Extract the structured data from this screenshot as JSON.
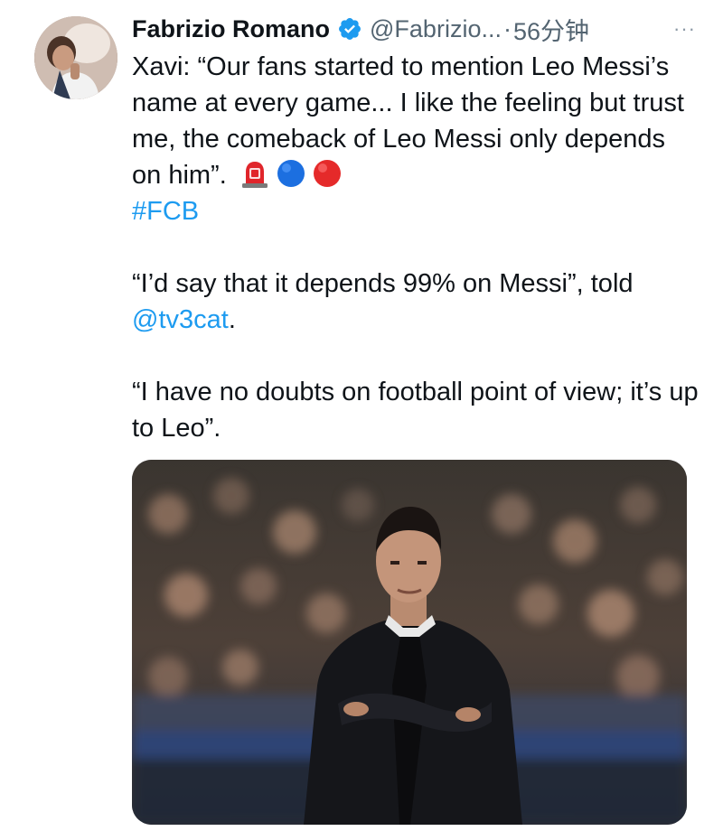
{
  "tweet": {
    "author_name": "Fabrizio Romano",
    "handle": "@Fabrizio...",
    "separator": "·",
    "time": "56分钟",
    "more": "···",
    "verified_color": "#1d9bf0",
    "body": {
      "p1_text": "Xavi: “Our fans started to mention Leo Messi’s name at every game... I like the feeling  but trust me, the comeback of Leo Messi only depends on him”.",
      "emoji_1": "rotating-light-icon",
      "emoji_2": "blue-circle-icon",
      "emoji_3": "red-circle-icon",
      "hashtag": "#FCB",
      "p2_text": "“I’d say that it depends 99% on Messi”, told",
      "mention": "@tv3cat",
      "p2_end": ".",
      "p3_text": "“I have no doubts on football point of view; it’s up to Leo”."
    },
    "media": {
      "icon": "photo-of-coach-icon"
    },
    "link_color": "#1d9bf0"
  }
}
